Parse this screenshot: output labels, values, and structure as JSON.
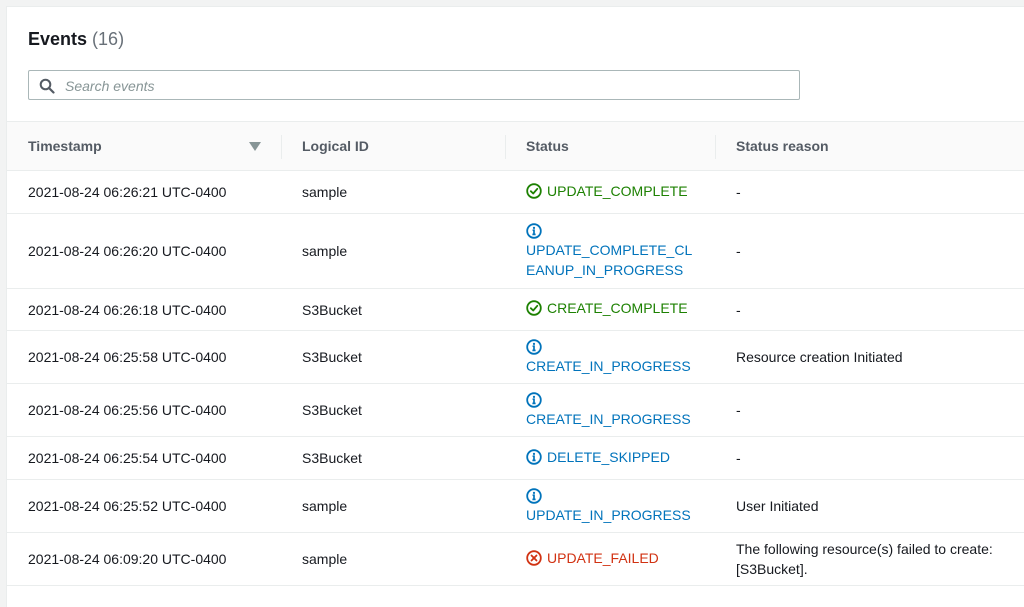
{
  "header": {
    "title": "Events",
    "count": "(16)"
  },
  "search": {
    "placeholder": "Search events"
  },
  "columns": {
    "timestamp": "Timestamp",
    "logical_id": "Logical ID",
    "status": "Status",
    "status_reason": "Status reason"
  },
  "rows": [
    {
      "timestamp": "2021-08-24 06:26:21 UTC-0400",
      "logical_id": "sample",
      "status_line1": "UPDATE_COMPLETE",
      "status_line2": "",
      "reason_line1": "-",
      "reason_line2": ""
    },
    {
      "timestamp": "2021-08-24 06:26:20 UTC-0400",
      "logical_id": "sample",
      "status_line1": "UPDATE_COMPLETE_CL",
      "status_line2": "EANUP_IN_PROGRESS",
      "reason_line1": "-",
      "reason_line2": ""
    },
    {
      "timestamp": "2021-08-24 06:26:18 UTC-0400",
      "logical_id": "S3Bucket",
      "status_line1": "CREATE_COMPLETE",
      "status_line2": "",
      "reason_line1": "-",
      "reason_line2": ""
    },
    {
      "timestamp": "2021-08-24 06:25:58 UTC-0400",
      "logical_id": "S3Bucket",
      "status_line1": "CREATE_IN_PROGRESS",
      "status_line2": "",
      "reason_line1": "Resource creation Initiated",
      "reason_line2": ""
    },
    {
      "timestamp": "2021-08-24 06:25:56 UTC-0400",
      "logical_id": "S3Bucket",
      "status_line1": "CREATE_IN_PROGRESS",
      "status_line2": "",
      "reason_line1": "-",
      "reason_line2": ""
    },
    {
      "timestamp": "2021-08-24 06:25:54 UTC-0400",
      "logical_id": "S3Bucket",
      "status_line1": "DELETE_SKIPPED",
      "status_line2": "",
      "reason_line1": "-",
      "reason_line2": ""
    },
    {
      "timestamp": "2021-08-24 06:25:52 UTC-0400",
      "logical_id": "sample",
      "status_line1": "UPDATE_IN_PROGRESS",
      "status_line2": "",
      "reason_line1": "User Initiated",
      "reason_line2": ""
    },
    {
      "timestamp": "2021-08-24 06:09:20 UTC-0400",
      "logical_id": "sample",
      "status_line1": "UPDATE_FAILED",
      "status_line2": "",
      "reason_line1": "The following resource(s) failed to create:",
      "reason_line2": "[S3Bucket]."
    }
  ],
  "icons": {
    "search": "search-icon",
    "sort": "sort-descending-icon",
    "success": "status-success-icon",
    "info": "status-info-icon",
    "error": "status-error-icon"
  },
  "colors": {
    "success": "#1d8102",
    "info": "#0073bb",
    "error": "#d13212"
  }
}
